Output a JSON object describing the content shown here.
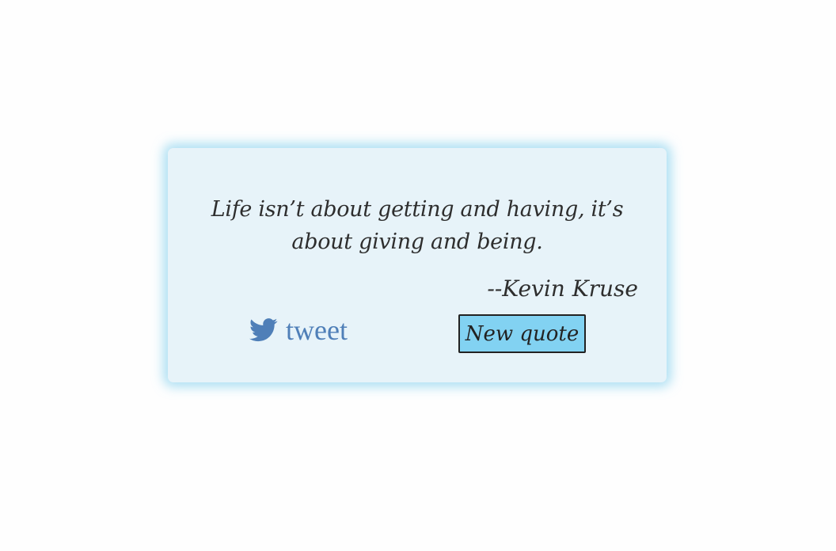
{
  "quote": {
    "text": "Life isn’t about getting and having, it’s about giving and being.",
    "author": "--Kevin Kruse"
  },
  "actions": {
    "tweet_label": "tweet",
    "tweet_icon": "twitter-bird-icon",
    "new_quote_label": "New quote"
  },
  "colors": {
    "card_background": "#e7f3f9",
    "card_glow": "#6ec8eb",
    "button_background": "#82d2f2",
    "tweet_color": "#4f7fb8",
    "text_color": "#2e2e2e"
  }
}
